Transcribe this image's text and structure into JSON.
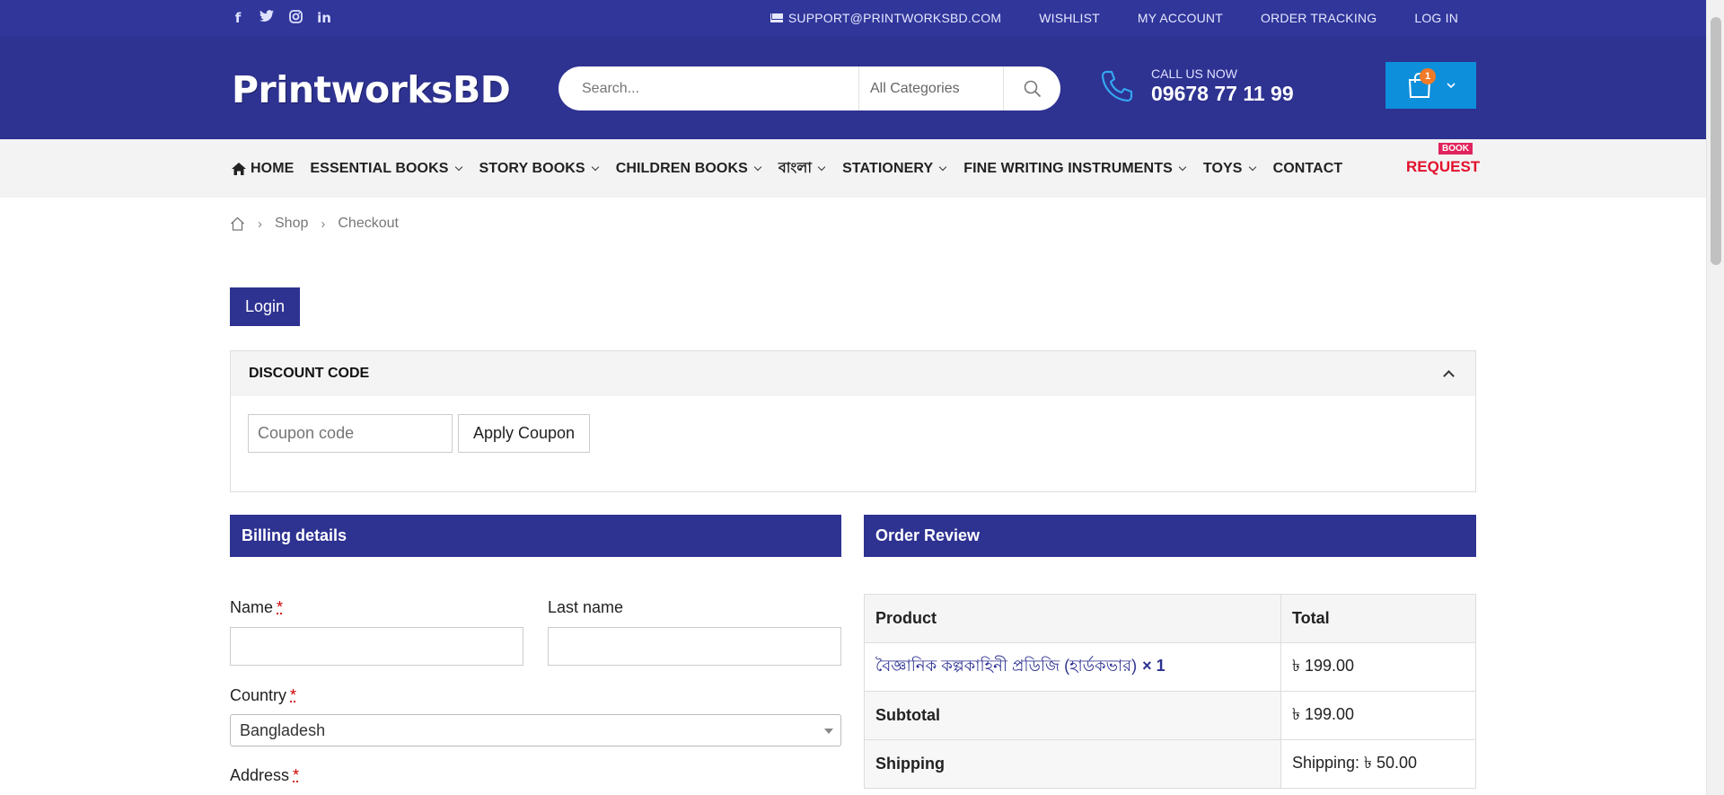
{
  "topbar": {
    "social": [
      "f",
      "t",
      "ig",
      "in"
    ],
    "support_email": "SUPPORT@PRINTWORKSBD.COM",
    "links": [
      "WISHLIST",
      "MY ACCOUNT",
      "ORDER TRACKING",
      "LOG IN"
    ]
  },
  "header": {
    "logo": "PrintworksBD",
    "search_placeholder": "Search...",
    "category": "All Categories",
    "call_label": "CALL US NOW",
    "phone": "09678 77 11 99",
    "cart_count": "1"
  },
  "nav": {
    "home": "HOME",
    "items": [
      "ESSENTIAL BOOKS",
      "STORY BOOKS",
      "CHILDREN BOOKS",
      "বাংলা",
      "STATIONERY",
      "FINE WRITING INSTRUMENTS",
      "TOYS"
    ],
    "contact": "CONTACT",
    "book_tag": "BOOK",
    "request": "REQUEST"
  },
  "breadcrumb": [
    "Shop",
    "Checkout"
  ],
  "login_label": "Login",
  "discount": {
    "title": "DISCOUNT CODE",
    "placeholder": "Coupon code",
    "apply": "Apply Coupon"
  },
  "billing": {
    "title": "Billing details",
    "name_label": "Name",
    "last_name_label": "Last name",
    "country_label": "Country",
    "country_value": "Bangladesh",
    "address_label": "Address",
    "required_mark": "*"
  },
  "order": {
    "title": "Order Review",
    "col_product": "Product",
    "col_total": "Total",
    "product_name": "বৈজ্ঞানিক কল্পকাহিনী প্রডিজি (হার্ডকভার)",
    "product_qty": "× 1",
    "product_total": "৳ 199.00",
    "subtotal_label": "Subtotal",
    "subtotal_value": "৳ 199.00",
    "shipping_label": "Shipping",
    "shipping_value": "Shipping: ৳ 50.00"
  },
  "colors": {
    "primary": "#2e3291",
    "topbar": "#30369a",
    "cart": "#0d8fdc",
    "request": "#e2102c",
    "badge": "#f07a28"
  }
}
